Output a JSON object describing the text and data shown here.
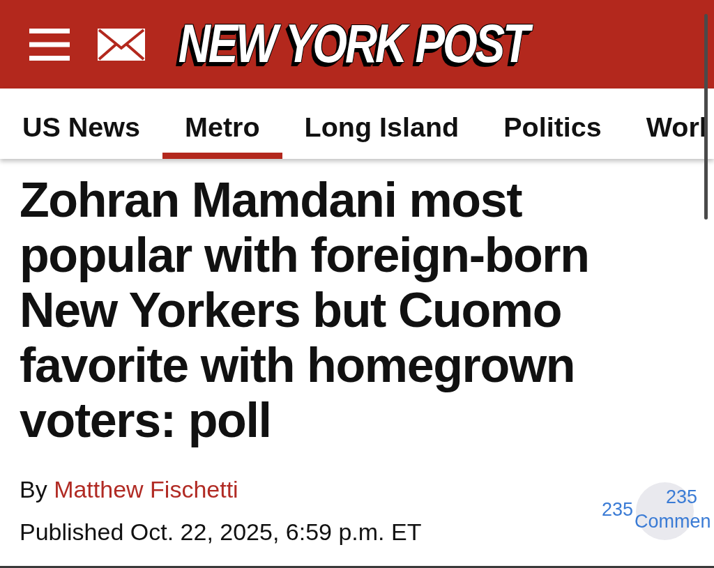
{
  "header": {
    "logo": "NEW YORK POST"
  },
  "nav": {
    "tabs": [
      {
        "label": "US News",
        "selected": false
      },
      {
        "label": "Metro",
        "selected": true
      },
      {
        "label": "Long Island",
        "selected": false
      },
      {
        "label": "Politics",
        "selected": false
      },
      {
        "label": "Worl",
        "selected": false
      }
    ]
  },
  "article": {
    "headline": "Zohran Mamdani most popular with foreign-born New Yorkers but Cuomo favorite with homegrown voters: poll",
    "byline": {
      "prefix": "By",
      "author": "Matthew Fischetti"
    },
    "published": "Published Oct. 22, 2025, 6:59 p.m. ET",
    "comments": {
      "count": "235",
      "badge_count": "235",
      "label": "Commen"
    }
  }
}
